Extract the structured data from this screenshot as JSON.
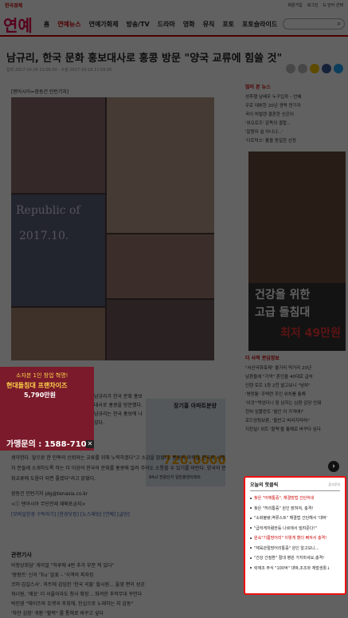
{
  "topbar": {
    "brand": "한국경제",
    "links": [
      "회원가입",
      "로그인",
      "G 언어 선택"
    ]
  },
  "nav": {
    "logo": "연예",
    "menu": [
      "홈",
      "연예뉴스",
      "연예가화제",
      "방송/TV",
      "드라마",
      "영화",
      "뮤직",
      "포토",
      "포토슬라이드"
    ]
  },
  "article": {
    "headline": "남규리, 한국 문화 홍보대사로 홍콩 방문 \"양국 교류에 힘쓸 것\"",
    "meta": "입력 2017-10-16 11:05:00 · 수정 2017-10-16 11:05:00",
    "caption": "[텐아시아=장동건 인턴기자]",
    "collage_text": "Republic of",
    "collage_date": "2017.10.",
    "body1": "남규리가 한국 문화 홍보대사로 홍콩을 방문했다. 남규리는 한국 홍보에 나섰다.",
    "body2": "생각한다. 앞으로 한 민족의 신뢰와는 교류를 위해 노력하겠다\"고 소감을 밝혔다. 홍콩의 마력을 한국의 시청자 분들께 소개하도록 하는 더 이상의 한국의 문화를 홍콩에 알려 주어도 소통할 수 있기를 바란다. 양국의 문화교류에 도움이 되면 좋겠다\"라고 밝혔다.",
    "reporter": "장동건 인턴기자 jdg@tenasia.co.kr",
    "copyright": "<ⓒ 텐아시아 무단전재 재배포금지>",
    "tags": "[모바일한경 구독하기] [한경닷컴] [뉴스래빗] [연예] [글방]"
  },
  "related": {
    "title": "관련기사",
    "items": [
      "비정상회담' 게이얼 \"하루에 4번 추가 부분 적 있다\"",
      "'팡팡트' 신곡 'Tru' 발표 – '식객의 피자킹",
      "코미·김길스사'. 마트에 갑입한 '한국 곡물' 할시원... 울영 편이 성공",
      "워너원, '깨끗' 더 서울이라도 청사 확장... 화려한 추억무대 꾸민다",
      "박진영 \"헤이즈와 듀엣곡 후회해, 진심으로 노래하는 지 감동\"",
      "'하얀 심장' 귀환 \"할력\" 를 통해로 바꾸고 싶다"
    ]
  },
  "left_ad": {
    "line1": "소자본 1인 창업 혁명!",
    "line2": "현대돌침대 프랜차이즈",
    "line3": "5,790만원",
    "phone": "가맹문의 : 1588-7105",
    "close": "✕"
  },
  "mid_ad": {
    "title": "장기홍 아파트분양",
    "price": "720.0000",
    "footer": "84㎡ 전용단지 일반분양아파트"
  },
  "sidebar": {
    "section1": "많이 본 뉴스",
    "items1": [
      "성추행 남배우 누구입까 – 안혜",
      "우로 데뷔한 20년 경력 연기자",
      "곡이 허벌렌 결혼한 신은이",
      "'위오로즈' 감독의 결합...",
      "'알렌자 실 아니냐...'",
      "'디트덕스' 활을 동일한 선정"
    ],
    "section2": "더 사적 관심정보",
    "items2": [
      "\"서산국화축제\" 올가리 먹거리 20년",
      "남편들에 \"기억\" 혼인율 40대로 급속",
      "인텐 토트 1등 2천 발고보니 \"넘쳐\"",
      "'명랑통' 주택연 주인 위치를 통해",
      "'이것'\"먹었더니 됨 남자는 님편 감당 안돼",
      "헌혀 임플란트 '월인 이 가격에?'",
      "로드앙림보론, '돌반고 버리지마라!'",
      "지친실! 위트 '할력'을 통해로 바꾸다 심다"
    ],
    "bed_ad_line1": "건강을 위한",
    "bed_ad_line2": "고급 돌침대",
    "bed_ad_price": "최저 49만원"
  },
  "popup": {
    "title": "오늘의 핫클릭",
    "ad_label": "광고문의",
    "items": [
      {
        "text": "찾은 \"어깨통증\", 해결방법 간단하네",
        "hl": true
      },
      {
        "text": "찾은 \"허리통증\" 원인 밝혀져, 충격!",
        "hl": false
      },
      {
        "text": "\"소화불량,역류스트\" 해결법 간단해서 '대박'",
        "hl": false
      },
      {
        "text": "\"급하게저렴한등 나르에서 빌려준다!\"",
        "hl": false
      },
      {
        "text": "원숙\"기름방어리\" 이렇게 했더 빠져서 충격!",
        "hl": true
      },
      {
        "text": "\"체육관절방어리통증\" 원인 알고보니...",
        "hl": false
      },
      {
        "text": "\"건강 간질환\" 절대 병원 가지마세요,충격!",
        "hl": false
      },
      {
        "text": "락재조 주식 \"100억\" 대박,조조와 재벌생활↓",
        "hl": false
      }
    ]
  },
  "next_arrow": "›"
}
